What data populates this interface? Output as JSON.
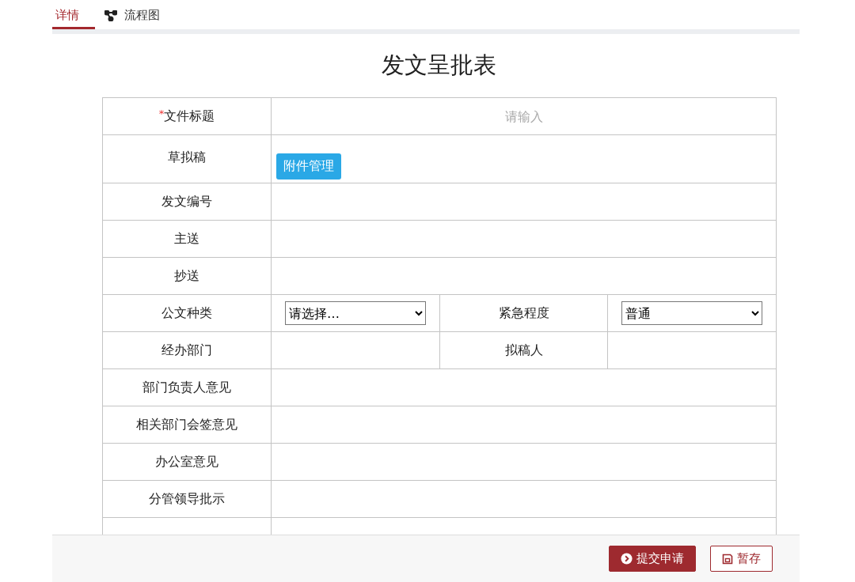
{
  "tabs": [
    {
      "kind": "plain",
      "label": "详情",
      "selected": true
    },
    {
      "kind": "diagram",
      "label": "流程图",
      "selected": false
    }
  ],
  "form": {
    "title": "发文呈批表",
    "rows": [
      {
        "kind": "input",
        "label": "文件标题",
        "mark": "*",
        "placeholder": "请输入"
      },
      {
        "kind": "attachment",
        "label": "草拟稿",
        "button": "附件管理"
      },
      {
        "kind": "blank",
        "label": "发文编号"
      },
      {
        "kind": "blank",
        "label": "主送"
      },
      {
        "kind": "blank",
        "label": "抄送"
      },
      {
        "kind": "split",
        "cells": [
          {
            "label": "公文种类",
            "select": "请选择…"
          },
          {
            "label": "紧急程度",
            "select": "普通"
          }
        ]
      },
      {
        "kind": "split",
        "cells": [
          {
            "label": "经办部门"
          },
          {
            "label": "拟稿人"
          }
        ]
      },
      {
        "kind": "blank",
        "label": "部门负责人意见"
      },
      {
        "kind": "blank",
        "label": "相关部门会签意见"
      },
      {
        "kind": "blank",
        "label": "办公室意见"
      },
      {
        "kind": "blank",
        "label": "分管领导批示"
      },
      {
        "kind": "blank"
      }
    ]
  },
  "footer": {
    "buttons": [
      {
        "kind": "primary",
        "label": "提交申请"
      },
      {
        "kind": "secondary",
        "label": "暂存"
      }
    ]
  }
}
